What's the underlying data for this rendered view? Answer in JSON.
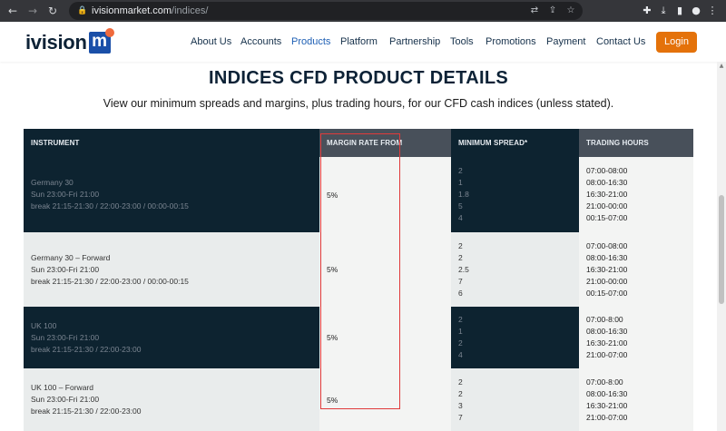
{
  "browser": {
    "url_host": "ivisionmarket.com",
    "url_path": "/indices/"
  },
  "site": {
    "logo_text": "ivision",
    "logo_mark": "m",
    "nav": [
      "About Us",
      "Accounts",
      "Products",
      "Platform",
      "Partnership",
      "Tools",
      "Promotions",
      "Payment",
      "Contact Us"
    ],
    "active_nav": "Products",
    "login_label": "Login",
    "accent_color": "#e4720a"
  },
  "page": {
    "title": "INDICES CFD PRODUCT DETAILS",
    "subtitle": "View our minimum spreads and margins, plus trading hours, for our CFD cash indices (unless stated)."
  },
  "table": {
    "headers": [
      "INSTRUMENT",
      "MARGIN RATE FROM",
      "MINIMUM SPREAD*",
      "TRADING HOURS"
    ],
    "rows": [
      {
        "name": "Germany 30",
        "session": "Sun 23:00-Fri 21:00",
        "breaks": "break 21:15-21:30 / 22:00-23:00 / 00:00-00:15",
        "margin": "5%",
        "spreads": [
          "2",
          "1",
          "1.8",
          "5",
          "4"
        ],
        "hours": [
          "07:00-08:00",
          "08:00-16:30",
          "16:30-21:00",
          "21:00-00:00",
          "00:15-07:00"
        ]
      },
      {
        "name": "Germany 30 – Forward",
        "session": "Sun 23:00-Fri 21:00",
        "breaks": "break 21:15-21:30 / 22:00-23:00 / 00:00-00:15",
        "margin": "5%",
        "spreads": [
          "2",
          "2",
          "2.5",
          "7",
          "6"
        ],
        "hours": [
          "07:00-08:00",
          "08:00-16:30",
          "16:30-21:00",
          "21:00-00:00",
          "00:15-07:00"
        ]
      },
      {
        "name": "UK 100",
        "session": "Sun 23:00-Fri 21:00",
        "breaks": "break 21:15-21:30 / 22:00-23:00",
        "margin": "5%",
        "spreads": [
          "2",
          "1",
          "2",
          "4"
        ],
        "hours": [
          "07:00-8:00",
          "08:00-16:30",
          "16:30-21:00",
          "21:00-07:00"
        ]
      },
      {
        "name": "UK 100 – Forward",
        "session": "Sun 23:00-Fri 21:00",
        "breaks": "break 21:15-21:30 / 22:00-23:00",
        "margin": "5%",
        "spreads": [
          "2",
          "2",
          "3",
          "7"
        ],
        "hours": [
          "07:00-8:00",
          "08:00-16:30",
          "16:30-21:00",
          "21:00-07:00"
        ]
      }
    ]
  },
  "highlight_color": "#e03a3a"
}
